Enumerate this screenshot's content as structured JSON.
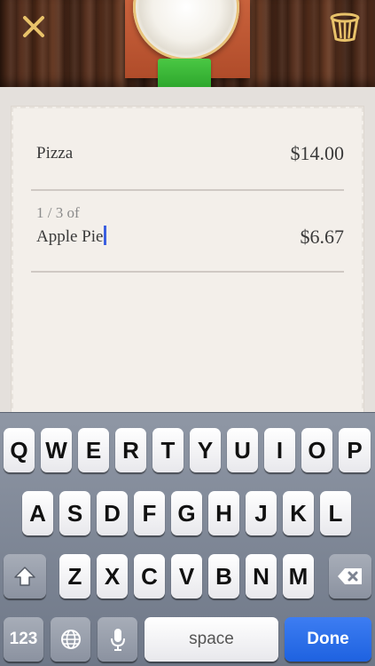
{
  "header": {
    "close_icon": "close-icon",
    "trash_icon": "trash-bucket-icon"
  },
  "receipt": {
    "items": [
      {
        "name": "Pizza",
        "price": "$14.00"
      },
      {
        "split": "1 / 3 of",
        "name": "Apple Pie",
        "price": "$6.67"
      }
    ]
  },
  "keyboard": {
    "row1": [
      "Q",
      "W",
      "E",
      "R",
      "T",
      "Y",
      "U",
      "I",
      "O",
      "P"
    ],
    "row2": [
      "A",
      "S",
      "D",
      "F",
      "G",
      "H",
      "J",
      "K",
      "L"
    ],
    "row3": [
      "Z",
      "X",
      "C",
      "V",
      "B",
      "N",
      "M"
    ],
    "numbers_label": "123",
    "space_label": "space",
    "done_label": "Done",
    "globe_icon": "globe-icon",
    "mic_icon": "microphone-icon",
    "shift_icon": "shift-icon",
    "delete_icon": "delete-icon"
  },
  "colors": {
    "done_blue": "#1e62e0",
    "cursor_blue": "#3b5fe0"
  }
}
